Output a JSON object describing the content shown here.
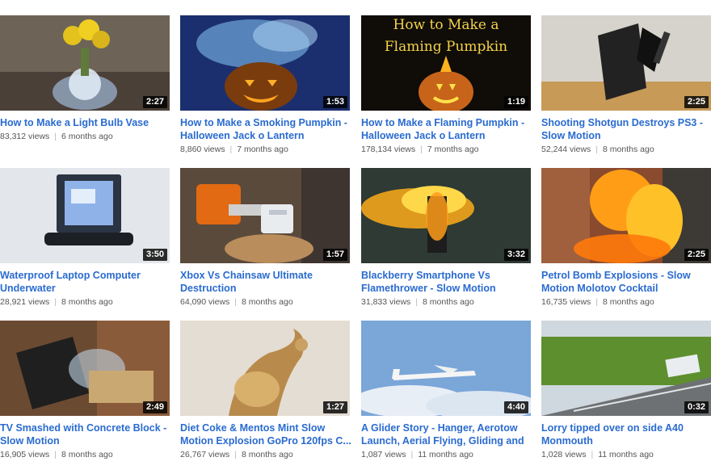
{
  "videos": [
    {
      "title": "How to Make a Light Bulb Vase",
      "views": "83,312 views",
      "age": "6 months ago",
      "duration": "2:27"
    },
    {
      "title": "How to Make a Smoking Pumpkin - Halloween Jack o Lantern",
      "views": "8,860 views",
      "age": "7 months ago",
      "duration": "1:53"
    },
    {
      "title": "How to Make a Flaming Pumpkin - Halloween Jack o Lantern",
      "views": "178,134 views",
      "age": "7 months ago",
      "duration": "1:19",
      "thumb_text": "How to Make a Flaming Pumpkin"
    },
    {
      "title": "Shooting Shotgun Destroys PS3 - Slow Motion",
      "views": "52,244 views",
      "age": "8 months ago",
      "duration": "2:25"
    },
    {
      "title": "Waterproof Laptop Computer Underwater",
      "views": "28,921 views",
      "age": "8 months ago",
      "duration": "3:50"
    },
    {
      "title": "Xbox Vs Chainsaw Ultimate Destruction",
      "views": "64,090 views",
      "age": "8 months ago",
      "duration": "1:57"
    },
    {
      "title": "Blackberry Smartphone Vs Flamethrower - Slow Motion",
      "views": "31,833 views",
      "age": "8 months ago",
      "duration": "3:32"
    },
    {
      "title": "Petrol Bomb Explosions - Slow Motion Molotov Cocktail",
      "views": "16,735 views",
      "age": "8 months ago",
      "duration": "2:25"
    },
    {
      "title": "TV Smashed with Concrete Block - Slow Motion",
      "views": "16,905 views",
      "age": "8 months ago",
      "duration": "2:49"
    },
    {
      "title": "Diet Coke & Mentos Mint Slow Motion Explosion GoPro 120fps C...",
      "views": "26,767 views",
      "age": "8 months ago",
      "duration": "1:27"
    },
    {
      "title": "A Glider Story - Hanger, Aerotow Launch, Aerial Flying, Gliding and ...",
      "views": "1,087 views",
      "age": "11 months ago",
      "duration": "4:40"
    },
    {
      "title": "Lorry tipped over on side A40 Monmouth",
      "views": "1,028 views",
      "age": "11 months ago",
      "duration": "0:32"
    }
  ]
}
